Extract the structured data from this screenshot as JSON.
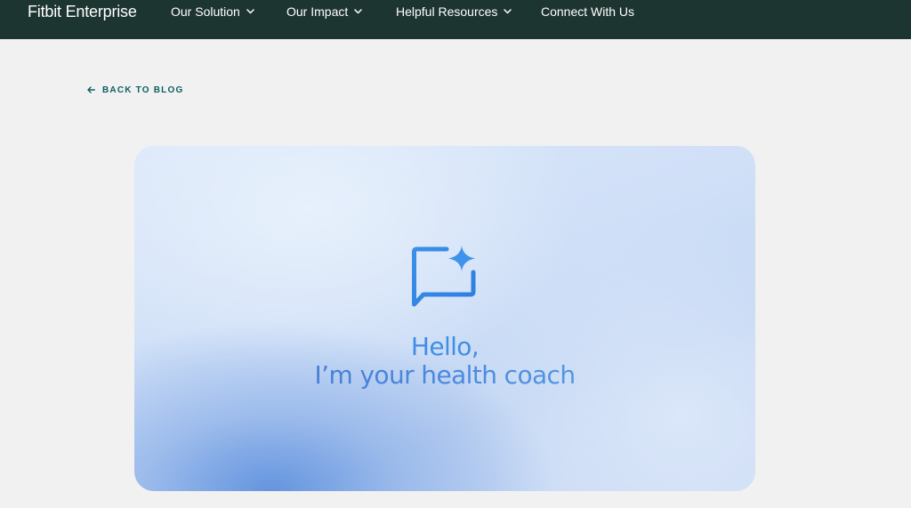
{
  "header": {
    "brand": "Fitbit Enterprise",
    "nav": [
      {
        "label": "Our Solution",
        "has_dropdown": true,
        "icon": "chevron-down-icon"
      },
      {
        "label": "Our Impact",
        "has_dropdown": true,
        "icon": "chevron-down-icon"
      },
      {
        "label": "Helpful Resources",
        "has_dropdown": true,
        "icon": "chevron-down-icon"
      },
      {
        "label": "Connect With Us",
        "has_dropdown": false
      }
    ],
    "background_color": "#1d3530",
    "text_color": "#ffffff"
  },
  "back_link": {
    "label": "BACK TO BLOG",
    "icon": "arrow-left-icon",
    "color": "#0e5f63"
  },
  "hero": {
    "icon": "chat-sparkle-icon",
    "line1": "Hello,",
    "line2": "I’m your health coach",
    "accent_color": "#3f8fe6"
  },
  "page": {
    "background_color": "#f1f1f1"
  }
}
